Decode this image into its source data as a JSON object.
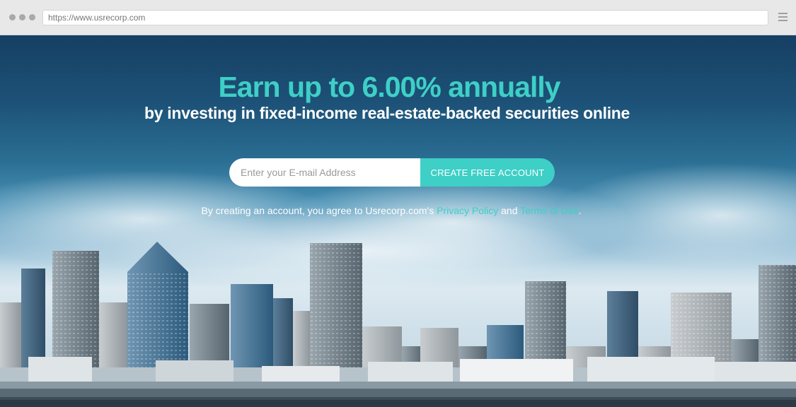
{
  "browser": {
    "url": "https://www.usrecorp.com"
  },
  "hero": {
    "headline": "Earn up to 6.00% annually",
    "subheadline": "by investing in fixed-income real-estate-backed securities online"
  },
  "signup": {
    "email_placeholder": "Enter your E-mail Address",
    "cta_label": "CREATE FREE ACCOUNT"
  },
  "legal": {
    "prefix": "By creating an account, you agree to Usrecorp.com's ",
    "privacy_link": "Privacy Policy",
    "and": " and ",
    "terms_link": "Terms of Use",
    "suffix": "."
  },
  "colors": {
    "accent": "#3ecfc6",
    "sky_top": "#163f63",
    "browser_chrome": "#e8e8e8"
  }
}
